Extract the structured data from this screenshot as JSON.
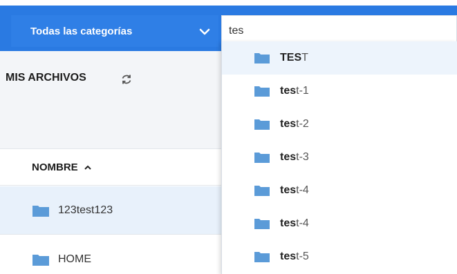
{
  "header": {
    "category_label": "Todas las categorías",
    "search_value": "tes"
  },
  "sidebar": {
    "section_title": "MIS ARCHIVOS",
    "column_header": "NOMBRE",
    "rows": [
      {
        "name": "123test123"
      },
      {
        "name": "HOME"
      }
    ]
  },
  "suggestions": [
    {
      "match": "TES",
      "rest": "T"
    },
    {
      "match": "tes",
      "rest": "t-1"
    },
    {
      "match": "tes",
      "rest": "t-2"
    },
    {
      "match": "tes",
      "rest": "t-3"
    },
    {
      "match": "tes",
      "rest": "t-4"
    },
    {
      "match": "tes",
      "rest": "t-4"
    },
    {
      "match": "tes",
      "rest": "t-5"
    }
  ],
  "colors": {
    "accent": "#2a7ae2",
    "folder": "#5b9bd8",
    "highlight": "#edf4fc"
  }
}
